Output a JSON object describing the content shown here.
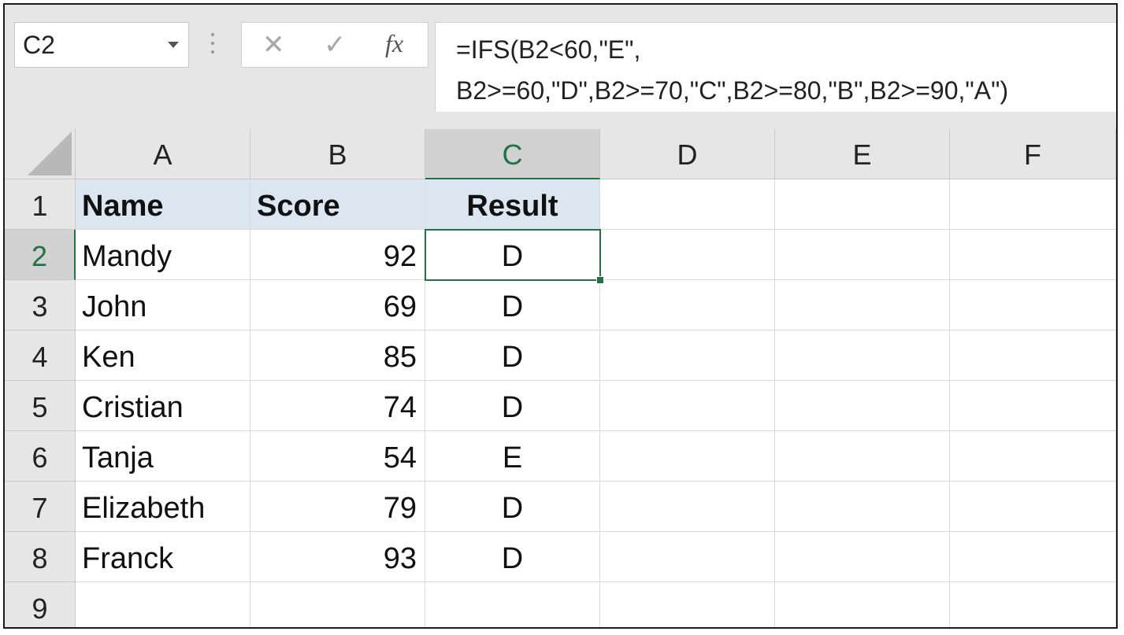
{
  "name_box": {
    "value": "C2"
  },
  "formula_bar": {
    "cancel_glyph": "✕",
    "enter_glyph": "✓",
    "fx_label": "fx",
    "formula_line1": "=IFS(B2<60,\"E\",",
    "formula_line2": "B2>=60,\"D\",B2>=70,\"C\",B2>=80,\"B\",B2>=90,\"A\")"
  },
  "sheet": {
    "columns": [
      "A",
      "B",
      "C",
      "D",
      "E",
      "F"
    ],
    "rows": [
      "1",
      "2",
      "3",
      "4",
      "5",
      "6",
      "7",
      "8",
      "9"
    ],
    "active_cell": "C2",
    "header_row": {
      "name": "Name",
      "score": "Score",
      "result": "Result"
    },
    "data": [
      {
        "name": "Mandy",
        "score": "92",
        "result": "D"
      },
      {
        "name": "John",
        "score": "69",
        "result": "D"
      },
      {
        "name": "Ken",
        "score": "85",
        "result": "D"
      },
      {
        "name": "Cristian",
        "score": "74",
        "result": "D"
      },
      {
        "name": "Tanja",
        "score": "54",
        "result": "E"
      },
      {
        "name": "Elizabeth",
        "score": "79",
        "result": "D"
      },
      {
        "name": "Franck",
        "score": "93",
        "result": "D"
      }
    ]
  },
  "colors": {
    "accent": "#217346",
    "header_fill": "#dce6f1",
    "header_bg": "#e6e6e6"
  }
}
